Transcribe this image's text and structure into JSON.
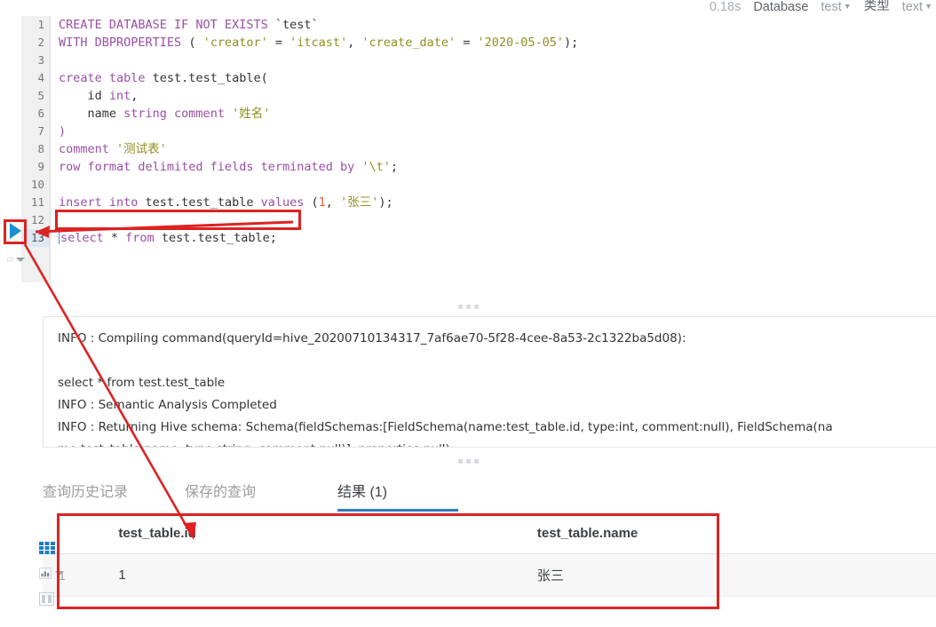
{
  "header": {
    "duration": "0.18s",
    "database_label": "Database",
    "database_value": "test",
    "type_label": "类型",
    "type_value": "text",
    "caret": "▼"
  },
  "editor": {
    "run_icon": "play-triangle-icon",
    "map_icon": "map-icon",
    "lines": [
      {
        "n": "1",
        "tokens": [
          {
            "t": "CREATE DATABASE IF NOT EXISTS ",
            "c": "kw"
          },
          {
            "t": "`test`",
            "c": "plain"
          }
        ]
      },
      {
        "n": "2",
        "tokens": [
          {
            "t": "WITH DBPROPERTIES ",
            "c": "kw"
          },
          {
            "t": "( ",
            "c": "plain"
          },
          {
            "t": "'creator'",
            "c": "str"
          },
          {
            "t": " = ",
            "c": "plain"
          },
          {
            "t": "'itcast'",
            "c": "str"
          },
          {
            "t": ", ",
            "c": "plain"
          },
          {
            "t": "'create_date'",
            "c": "str"
          },
          {
            "t": " = ",
            "c": "plain"
          },
          {
            "t": "'2020-05-05'",
            "c": "str"
          },
          {
            "t": ");",
            "c": "plain"
          }
        ]
      },
      {
        "n": "3",
        "tokens": []
      },
      {
        "n": "4",
        "tokens": [
          {
            "t": "create table ",
            "c": "kw"
          },
          {
            "t": "test.test_table(",
            "c": "plain"
          }
        ]
      },
      {
        "n": "5",
        "tokens": [
          {
            "t": "    id ",
            "c": "plain"
          },
          {
            "t": "int",
            "c": "kw"
          },
          {
            "t": ",",
            "c": "plain"
          }
        ]
      },
      {
        "n": "6",
        "tokens": [
          {
            "t": "    name ",
            "c": "plain"
          },
          {
            "t": "string comment ",
            "c": "kw"
          },
          {
            "t": "'姓名'",
            "c": "str"
          }
        ]
      },
      {
        "n": "7",
        "tokens": [
          {
            "t": ")",
            "c": "kw"
          }
        ]
      },
      {
        "n": "8",
        "tokens": [
          {
            "t": "comment ",
            "c": "kw"
          },
          {
            "t": "'测试表'",
            "c": "str"
          }
        ]
      },
      {
        "n": "9",
        "tokens": [
          {
            "t": "row format delimited fields terminated by ",
            "c": "kw"
          },
          {
            "t": "'\\t'",
            "c": "str"
          },
          {
            "t": ";",
            "c": "plain"
          }
        ]
      },
      {
        "n": "10",
        "tokens": []
      },
      {
        "n": "11",
        "tokens": [
          {
            "t": "insert into ",
            "c": "kw"
          },
          {
            "t": "test.test_table ",
            "c": "plain"
          },
          {
            "t": "values ",
            "c": "kw"
          },
          {
            "t": "(",
            "c": "plain"
          },
          {
            "t": "1",
            "c": "num-lit"
          },
          {
            "t": ", ",
            "c": "plain"
          },
          {
            "t": "'张三'",
            "c": "str"
          },
          {
            "t": ");",
            "c": "plain"
          }
        ]
      },
      {
        "n": "12",
        "tokens": []
      },
      {
        "n": "13",
        "active": true,
        "tokens": [
          {
            "t": "select ",
            "c": "kw"
          },
          {
            "t": "* ",
            "c": "plain"
          },
          {
            "t": "from ",
            "c": "kw"
          },
          {
            "t": "test.test_table;",
            "c": "plain"
          }
        ]
      }
    ]
  },
  "log": {
    "lines": [
      "INFO   : Compiling command(queryId=hive_20200710134317_7af6ae70-5f28-4cee-8a53-2c1322ba5d08):",
      "",
      "select * from test.test_table",
      "INFO   : Semantic Analysis Completed",
      "INFO   : Returning Hive schema: Schema(fieldSchemas:[FieldSchema(name:test_table.id, type:int, comment:null), FieldSchema(na",
      "me:test_table.name, type:string, comment:null)], properties:null)"
    ]
  },
  "tabs": [
    {
      "label": "查询历史记录",
      "active": false
    },
    {
      "label": "保存的查询",
      "active": false
    },
    {
      "label": "结果 (1)",
      "active": true
    }
  ],
  "results": {
    "columns": [
      "",
      "test_table.id",
      "test_table.name"
    ],
    "rows": [
      {
        "rownum": "1",
        "id": "1",
        "name": "张三"
      }
    ]
  },
  "rail": {
    "grid_icon": "grid-table-icon",
    "chart_icon": "bar-chart-icon",
    "columns_icon": "columns-icon"
  },
  "annotations": {
    "highlight_color": "#dd2222"
  }
}
